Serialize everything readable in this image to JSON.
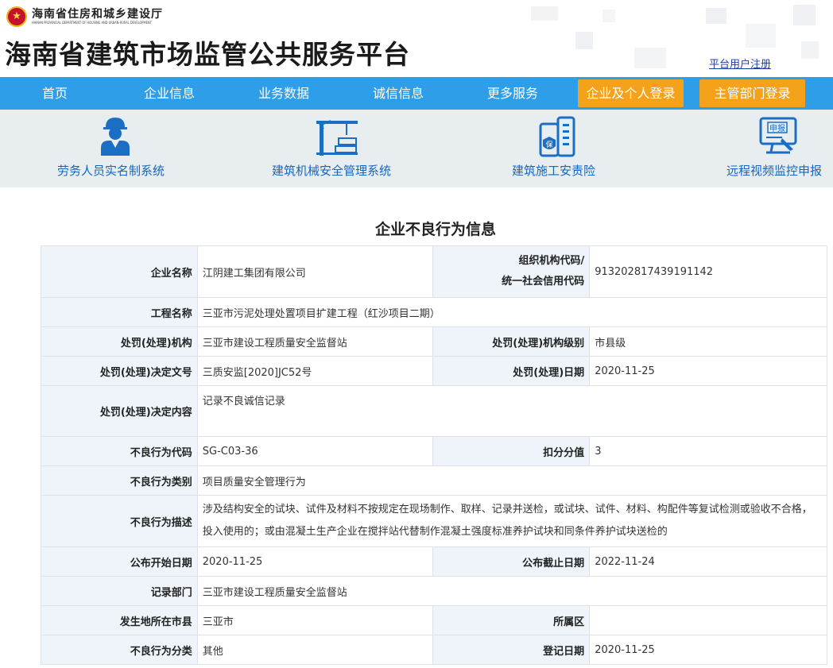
{
  "header": {
    "dept_cn": "海南省住房和城乡建设厅",
    "dept_en": "HAINAN PROVINCIAL DEPARTMENT OF HOUSING AND URBAN-RURAL DEVELOPMENT",
    "platform_title": "海南省建筑市场监管公共服务平台",
    "register_link": "平台用户注册"
  },
  "nav": {
    "items": [
      "首页",
      "企业信息",
      "业务数据",
      "诚信信息",
      "更多服务"
    ],
    "login_company": "企业及个人登录",
    "login_admin": "主管部门登录"
  },
  "systems": [
    {
      "label": "劳务人员实名制系统",
      "icon": "worker-icon"
    },
    {
      "label": "建筑机械安全管理系统",
      "icon": "crane-icon"
    },
    {
      "label": "建筑施工安责险",
      "icon": "insurance-building-icon"
    },
    {
      "label": "远程视频监控申报",
      "icon": "monitor-report-icon",
      "icon_text": "申报"
    }
  ],
  "page_heading": "企业不良行为信息",
  "record": {
    "company_name_label": "企业名称",
    "company_name": "江阴建工集团有限公司",
    "org_code_label_1": "组织机构代码/",
    "org_code_label_2": "统一社会信用代码",
    "org_code": "913202817439191142",
    "project_label": "工程名称",
    "project": "三亚市污泥处理处置项目扩建工程（红沙项目二期）",
    "agency_label": "处罚(处理)机构",
    "agency": "三亚市建设工程质量安全监督站",
    "agency_level_label": "处罚(处理)机构级别",
    "agency_level": "市县级",
    "decision_no_label": "处罚(处理)决定文号",
    "decision_no": "三质安监[2020]JC52号",
    "decision_date_label": "处罚(处理)日期",
    "decision_date": "2020-11-25",
    "decision_content_label": "处罚(处理)决定内容",
    "decision_content": "记录不良诚信记录",
    "behavior_code_label": "不良行为代码",
    "behavior_code": "SG-C03-36",
    "deduction_label": "扣分分值",
    "deduction": "3",
    "category_label": "不良行为类别",
    "category": "项目质量安全管理行为",
    "description_label": "不良行为描述",
    "description": "涉及结构安全的试块、试件及材料不按规定在现场制作、取样、记录并送检，或试块、试件、材料、构配件等复试检测或验收不合格，投入使用的；或由混凝土生产企业在搅拌站代替制作混凝土强度标准养护试块和同条件养护试块送检的",
    "publish_start_label": "公布开始日期",
    "publish_start": "2020-11-25",
    "publish_end_label": "公布截止日期",
    "publish_end": "2022-11-24",
    "record_dept_label": "记录部门",
    "record_dept": "三亚市建设工程质量安全监督站",
    "city_label": "发生地所在市县",
    "city": "三亚市",
    "district_label": "所属区",
    "district": "",
    "classification_label": "不良行为分类",
    "classification": "其他",
    "register_date_label": "登记日期",
    "register_date": "2020-11-25"
  }
}
